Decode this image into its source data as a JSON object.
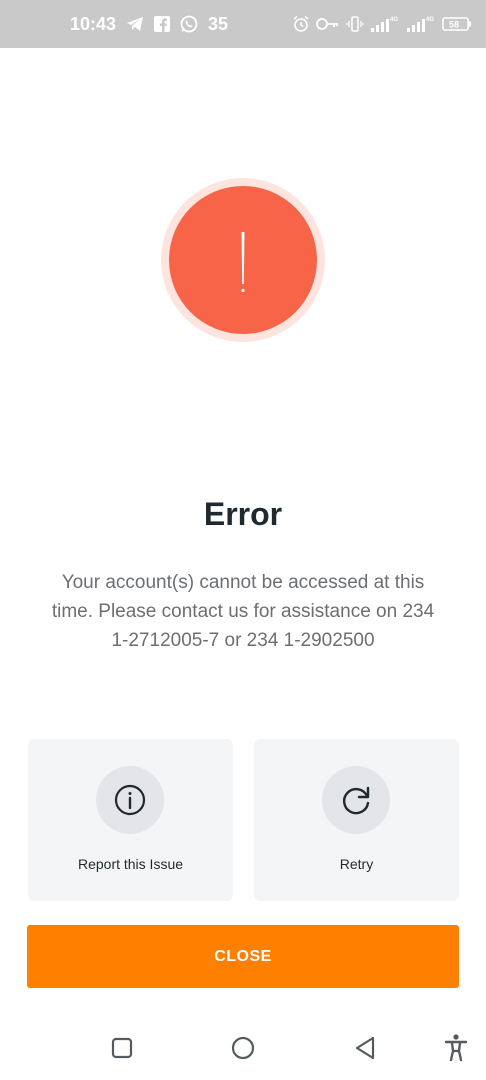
{
  "status_bar": {
    "time": "10:43",
    "notification_count": "35",
    "battery_level": "58"
  },
  "dialog": {
    "title": "Error",
    "message": "Your account(s) cannot be accessed at this time. Please contact us for assistance on 234 1-2712005-7 or 234 1-2902500",
    "icon": "exclamation-icon",
    "accent_color": "#f76448"
  },
  "actions": {
    "report": {
      "label": "Report this Issue",
      "icon": "info-icon"
    },
    "retry": {
      "label": "Retry",
      "icon": "refresh-icon"
    }
  },
  "close_button": {
    "label": "CLOSE",
    "color": "#ff8000"
  },
  "nav": {
    "recents_icon": "square-icon",
    "home_icon": "circle-icon",
    "back_icon": "triangle-back-icon",
    "accessibility_icon": "accessibility-icon"
  }
}
